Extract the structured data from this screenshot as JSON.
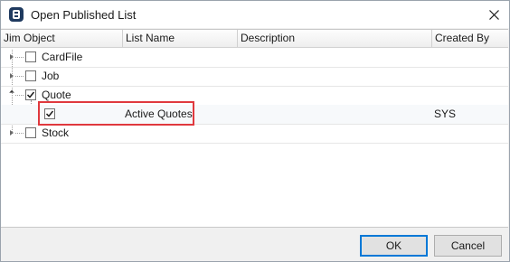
{
  "window": {
    "title": "Open Published List"
  },
  "columns": [
    "Jim Object",
    "List Name",
    "Description",
    "Created By"
  ],
  "tree": {
    "nodes": [
      {
        "label": "CardFile",
        "checked": false,
        "expanded": false
      },
      {
        "label": "Job",
        "checked": false,
        "expanded": false
      },
      {
        "label": "Quote",
        "checked": true,
        "expanded": true,
        "children": [
          {
            "checked": true,
            "list_name": "Active Quotes",
            "description": "",
            "created_by": "SYS"
          }
        ]
      },
      {
        "label": "Stock",
        "checked": false,
        "expanded": false
      }
    ]
  },
  "buttons": {
    "ok_label": "OK",
    "cancel_label": "Cancel"
  },
  "colors": {
    "highlight": "#e0393e",
    "default_button_border": "#0078d7"
  }
}
